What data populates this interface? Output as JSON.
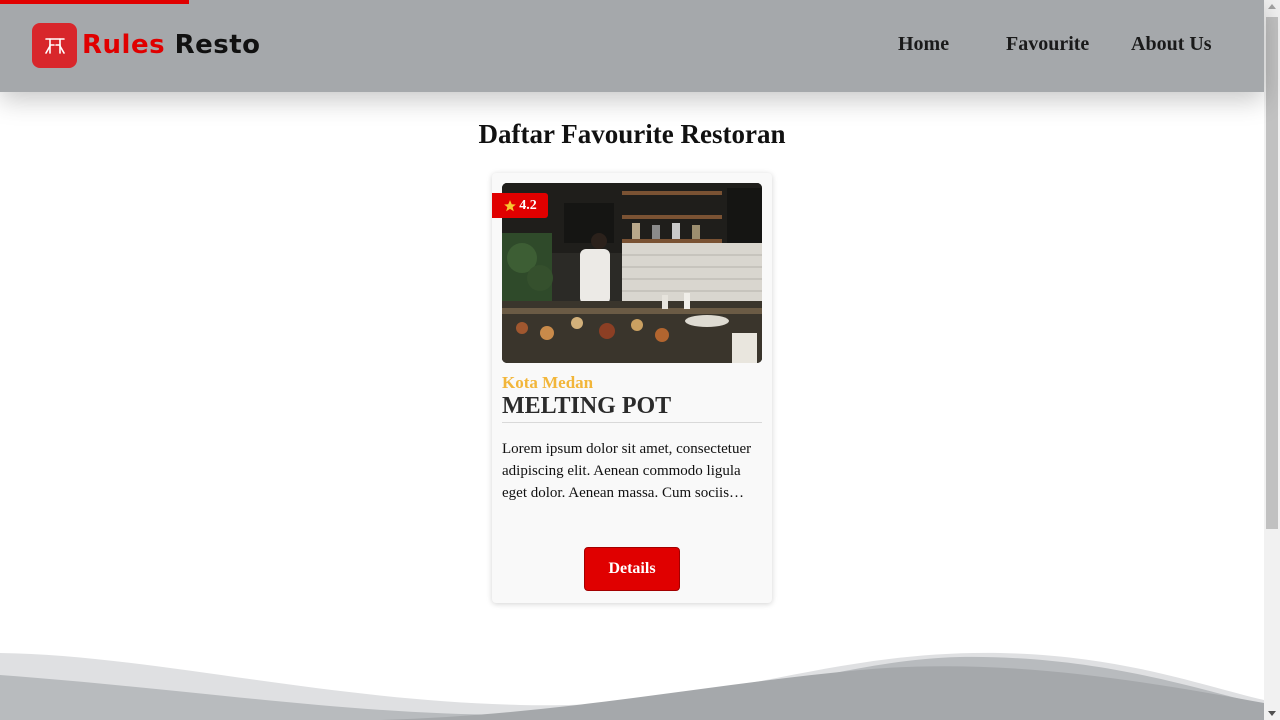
{
  "brand": {
    "rules": "Rules",
    "resto": "Resto",
    "logo_icon": "rr-monogram-icon",
    "accent": "#e00000"
  },
  "nav": {
    "items": [
      {
        "label": "Home"
      },
      {
        "label": "Favourite"
      },
      {
        "label": "About Us"
      }
    ]
  },
  "page": {
    "title": "Daftar Favourite Restoran"
  },
  "restaurants": [
    {
      "rating": "4.2",
      "city": "Kota Medan",
      "name": "MELTING POT",
      "description": "Lorem ipsum dolor sit amet, consectetuer adipiscing elit. Aenean commodo ligula eget dolor. Aenean massa. Cum sociis…",
      "button_label": "Details",
      "rating_icon": "star-icon"
    }
  ],
  "colors": {
    "header": "#a5a8ab",
    "badge": "#e00000",
    "city": "#f2b63a"
  }
}
